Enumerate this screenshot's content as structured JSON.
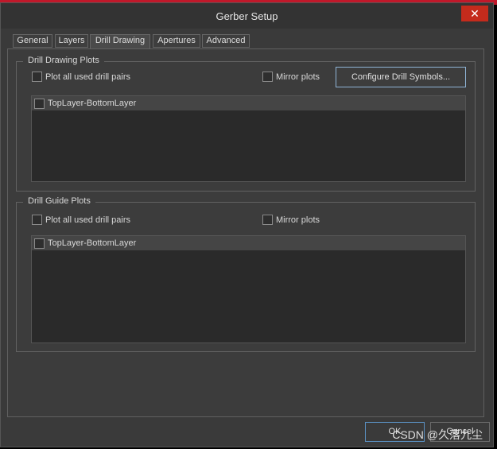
{
  "window": {
    "title": "Gerber Setup",
    "close_glyph": "✕"
  },
  "tabs": [
    {
      "label": "General"
    },
    {
      "label": "Layers"
    },
    {
      "label": "Drill Drawing",
      "active": true
    },
    {
      "label": "Apertures"
    },
    {
      "label": "Advanced"
    }
  ],
  "drill_drawing": {
    "group_label": "Drill Drawing Plots",
    "plot_all_label": "Plot all used drill pairs",
    "plot_all_checked": false,
    "mirror_label": "Mirror plots",
    "mirror_checked": false,
    "configure_label": "Configure Drill Symbols...",
    "layers": [
      {
        "label": "TopLayer-BottomLayer",
        "checked": false
      }
    ]
  },
  "drill_guide": {
    "group_label": "Drill Guide Plots",
    "plot_all_label": "Plot all used drill pairs",
    "plot_all_checked": false,
    "mirror_label": "Mirror plots",
    "mirror_checked": false,
    "layers": [
      {
        "label": "TopLayer-BottomLayer",
        "checked": false
      }
    ]
  },
  "footer": {
    "ok_label": "OK",
    "cancel_label": "Cancel"
  },
  "watermark": "CSDN @久落九尘",
  "colors": {
    "accent": "#8fb4d6",
    "close": "#c42b1c",
    "panel": "#3c3c3c"
  }
}
